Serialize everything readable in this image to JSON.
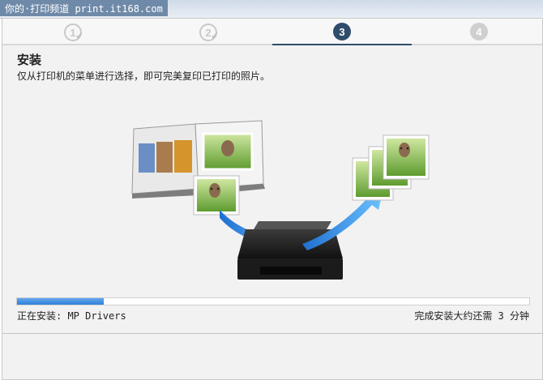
{
  "watermark": {
    "text": "你的·打印频道 print.it168.com"
  },
  "steps": {
    "items": [
      {
        "label": "1",
        "state": "done"
      },
      {
        "label": "2",
        "state": "done"
      },
      {
        "label": "3",
        "state": "current"
      },
      {
        "label": "4",
        "state": "todo"
      }
    ]
  },
  "page": {
    "title": "安装",
    "subtitle": "仅从打印机的菜单进行选择，即可完美复印已打印的照片。"
  },
  "progress": {
    "fraction": 0.17
  },
  "status": {
    "installing": "正在安装: MP Drivers",
    "remaining": "完成安装大约还需 3 分钟"
  },
  "colors": {
    "accent": "#2f4d6b",
    "progress": "#3b8be0",
    "arrow": "#2e8de6"
  },
  "icons": {
    "step_done": "check-icon",
    "printer": "printer-icon",
    "arrow": "arrow-icon"
  }
}
